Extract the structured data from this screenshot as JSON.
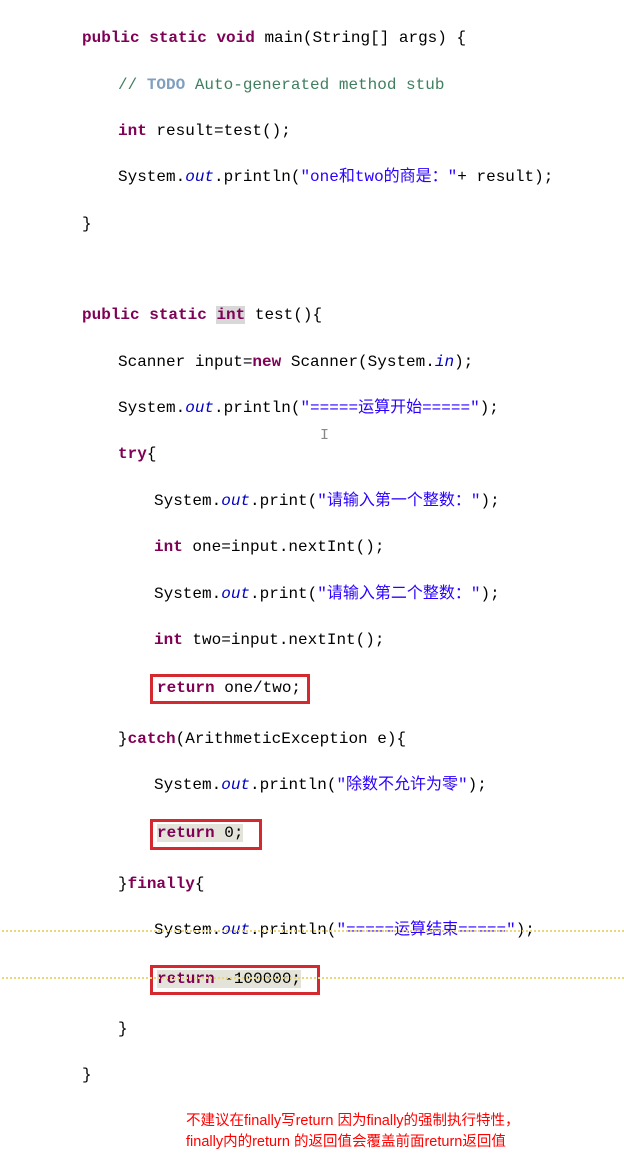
{
  "code": {
    "l1_kw1": "public",
    "l1_kw2": "static",
    "l1_kw3": "void",
    "l1_main": "main(String[] args) {",
    "l2_todo_pre": "// ",
    "l2_todo": "TODO",
    "l2_todo_post": " Auto-generated method stub",
    "l3_kw": "int",
    "l3_rest": " result=test();",
    "l4_a": "System.",
    "l4_out": "out",
    "l4_b": ".println(",
    "l4_str": "\"one和two的商是：\"",
    "l4_c": "+ result);",
    "l5": "}",
    "l6_kw1": "public",
    "l6_kw2": "static",
    "l6_int": "int",
    "l6_rest": " test(){",
    "l7_a": "Scanner input=",
    "l7_kw": "new",
    "l7_b": " Scanner(System.",
    "l7_in": "in",
    "l7_c": ");",
    "l8_a": "System.",
    "l8_out": "out",
    "l8_b": ".println(",
    "l8_str": "\"=====运算开始=====\"",
    "l8_c": ");",
    "l9_kw": "try",
    "l9_rest": "{",
    "l10_a": "System.",
    "l10_out": "out",
    "l10_b": ".print(",
    "l10_str": "\"请输入第一个整数：\"",
    "l10_c": ");",
    "l11_kw": "int",
    "l11_rest": " one=input.nextInt();",
    "l12_a": "System.",
    "l12_out": "out",
    "l12_b": ".print(",
    "l12_str": "\"请输入第二个整数：\"",
    "l12_c": ");",
    "l13_kw": "int",
    "l13_rest": " two=input.nextInt();",
    "l14_kw": "return",
    "l14_rest": " one/two;",
    "l15_a": "}",
    "l15_kw": "catch",
    "l15_b": "(ArithmeticException e){",
    "l16_a": "System.",
    "l16_out": "out",
    "l16_b": ".println(",
    "l16_str": "\"除数不允许为零\"",
    "l16_c": ");",
    "l17_kw": "return",
    "l17_rest": " 0;",
    "l18_a": "}",
    "l18_kw": "finally",
    "l18_b": "{",
    "l19_a": "System.",
    "l19_out": "out",
    "l19_b": ".println(",
    "l19_str": "\"=====运算结束=====\"",
    "l19_c": ");",
    "l20_kw": "return",
    "l20_rest": " -100000;",
    "l21": "}",
    "l22": "}"
  },
  "note": {
    "line1": "不建议在finally写return 因为finally的强制执行特性，",
    "line2": "finally内的return 的返回值会覆盖前面return返回值"
  }
}
